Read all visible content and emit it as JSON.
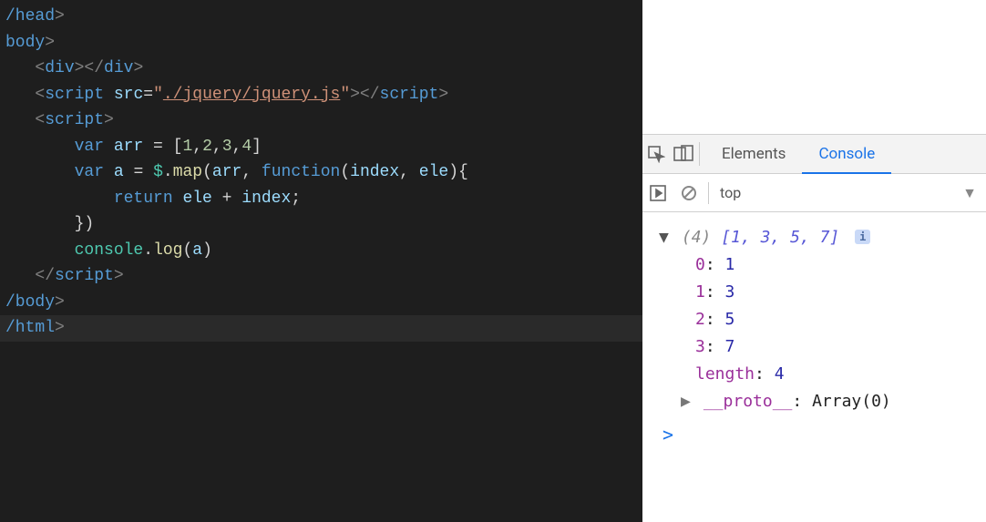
{
  "editor": {
    "lines": [
      {
        "indent": "",
        "tokens": [
          {
            "t": "/head",
            "c": "tok-tag"
          },
          {
            "t": ">",
            "c": "tok-punc"
          }
        ]
      },
      {
        "indent": "",
        "tokens": [
          {
            "t": "body",
            "c": "tok-tag"
          },
          {
            "t": ">",
            "c": "tok-punc"
          }
        ]
      },
      {
        "indent": "   ",
        "tokens": [
          {
            "t": "<",
            "c": "tok-punc"
          },
          {
            "t": "div",
            "c": "tok-tag"
          },
          {
            "t": "></",
            "c": "tok-punc"
          },
          {
            "t": "div",
            "c": "tok-tag"
          },
          {
            "t": ">",
            "c": "tok-punc"
          }
        ]
      },
      {
        "indent": "   ",
        "tokens": [
          {
            "t": "<",
            "c": "tok-punc"
          },
          {
            "t": "script ",
            "c": "tok-tag"
          },
          {
            "t": "src",
            "c": "tok-attr"
          },
          {
            "t": "=",
            "c": "tok-op"
          },
          {
            "t": "\"",
            "c": "tok-str"
          },
          {
            "t": "./jquery/jquery.js",
            "c": "tok-str under"
          },
          {
            "t": "\"",
            "c": "tok-str"
          },
          {
            "t": "></",
            "c": "tok-punc"
          },
          {
            "t": "script",
            "c": "tok-tag"
          },
          {
            "t": ">",
            "c": "tok-punc"
          }
        ]
      },
      {
        "indent": "   ",
        "tokens": [
          {
            "t": "<",
            "c": "tok-punc"
          },
          {
            "t": "script",
            "c": "tok-tag"
          },
          {
            "t": ">",
            "c": "tok-punc"
          }
        ]
      },
      {
        "indent": "       ",
        "tokens": [
          {
            "t": "var ",
            "c": "tok-kw"
          },
          {
            "t": "arr",
            "c": "tok-var"
          },
          {
            "t": " = [",
            "c": "tok-op"
          },
          {
            "t": "1",
            "c": "tok-num"
          },
          {
            "t": ",",
            "c": "tok-op"
          },
          {
            "t": "2",
            "c": "tok-num"
          },
          {
            "t": ",",
            "c": "tok-op"
          },
          {
            "t": "3",
            "c": "tok-num"
          },
          {
            "t": ",",
            "c": "tok-op"
          },
          {
            "t": "4",
            "c": "tok-num"
          },
          {
            "t": "]",
            "c": "tok-op"
          }
        ]
      },
      {
        "indent": "       ",
        "tokens": [
          {
            "t": "var ",
            "c": "tok-kw"
          },
          {
            "t": "a",
            "c": "tok-var"
          },
          {
            "t": " = ",
            "c": "tok-op"
          },
          {
            "t": "$",
            "c": "tok-obj"
          },
          {
            "t": ".",
            "c": "tok-op"
          },
          {
            "t": "map",
            "c": "tok-fn"
          },
          {
            "t": "(",
            "c": "tok-op"
          },
          {
            "t": "arr",
            "c": "tok-var"
          },
          {
            "t": ", ",
            "c": "tok-op"
          },
          {
            "t": "function",
            "c": "tok-kw"
          },
          {
            "t": "(",
            "c": "tok-op"
          },
          {
            "t": "index",
            "c": "tok-var"
          },
          {
            "t": ", ",
            "c": "tok-op"
          },
          {
            "t": "ele",
            "c": "tok-var"
          },
          {
            "t": "){",
            "c": "tok-op"
          }
        ]
      },
      {
        "indent": "           ",
        "tokens": [
          {
            "t": "return ",
            "c": "tok-kw"
          },
          {
            "t": "ele",
            "c": "tok-var"
          },
          {
            "t": " + ",
            "c": "tok-op"
          },
          {
            "t": "index",
            "c": "tok-var"
          },
          {
            "t": ";",
            "c": "tok-op"
          }
        ]
      },
      {
        "indent": "       ",
        "tokens": [
          {
            "t": "})",
            "c": "tok-op"
          }
        ]
      },
      {
        "indent": "",
        "tokens": []
      },
      {
        "indent": "       ",
        "tokens": [
          {
            "t": "console",
            "c": "tok-obj"
          },
          {
            "t": ".",
            "c": "tok-op"
          },
          {
            "t": "log",
            "c": "tok-fn"
          },
          {
            "t": "(",
            "c": "tok-op"
          },
          {
            "t": "a",
            "c": "tok-var"
          },
          {
            "t": ")",
            "c": "tok-op"
          }
        ]
      },
      {
        "indent": "   ",
        "tokens": [
          {
            "t": "</",
            "c": "tok-punc"
          },
          {
            "t": "script",
            "c": "tok-tag"
          },
          {
            "t": ">",
            "c": "tok-punc"
          }
        ]
      },
      {
        "indent": "",
        "tokens": [
          {
            "t": "/body",
            "c": "tok-tag"
          },
          {
            "t": ">",
            "c": "tok-punc"
          }
        ]
      },
      {
        "indent": "",
        "current": true,
        "tokens": [
          {
            "t": "/html",
            "c": "tok-tag"
          },
          {
            "t": "",
            "c": "cursor"
          }
        ]
      }
    ]
  },
  "devtools": {
    "tabs": {
      "elements": "Elements",
      "console": "Console",
      "active": "Console"
    },
    "toolbar": {
      "context": "top"
    },
    "log": {
      "length": 4,
      "preview": "[1, 3, 5, 7]",
      "entries": [
        {
          "key": "0",
          "value": "1"
        },
        {
          "key": "1",
          "value": "3"
        },
        {
          "key": "2",
          "value": "5"
        },
        {
          "key": "3",
          "value": "7"
        }
      ],
      "lengthLabel": "length",
      "lengthVal": "4",
      "protoLabel": "__proto__",
      "protoVal": "Array(0)"
    },
    "info_badge": "i",
    "prompt": ">"
  }
}
